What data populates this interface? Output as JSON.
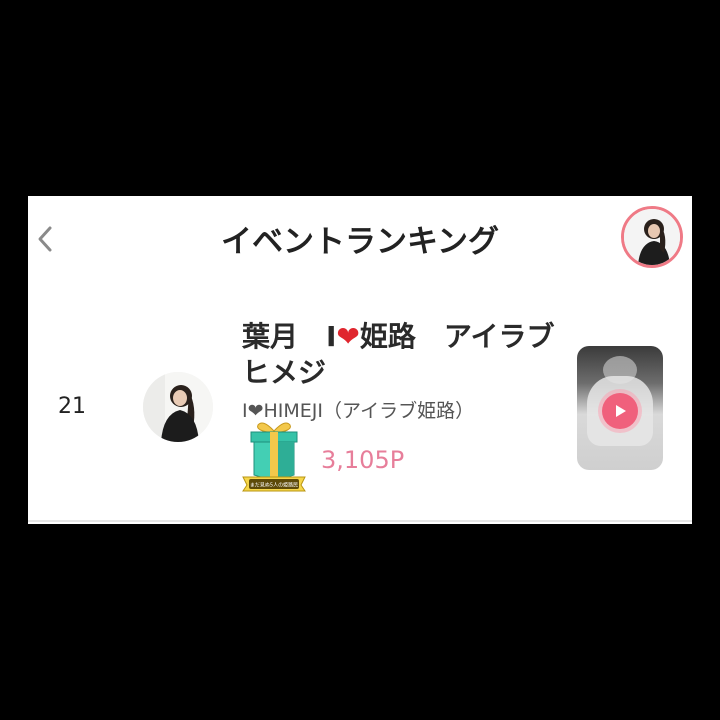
{
  "header": {
    "title": "イベントランキング",
    "back_icon": "chevron-left-icon",
    "profile_icon": "avatar"
  },
  "entry": {
    "rank": "21",
    "name_part1": "葉月　I",
    "name_heart": "❤",
    "name_part2": "姫路　アイラブヒメジ",
    "event": "I❤HIMEJI（アイラブ姫路）",
    "badge_text": "まだ見ぬ5人の姫路民",
    "points": "3,105P",
    "video_icon": "play-icon"
  },
  "colors": {
    "accent": "#ef7a86",
    "points": "#e77e9a",
    "heart": "#e0262e",
    "play": "#f0607c"
  }
}
